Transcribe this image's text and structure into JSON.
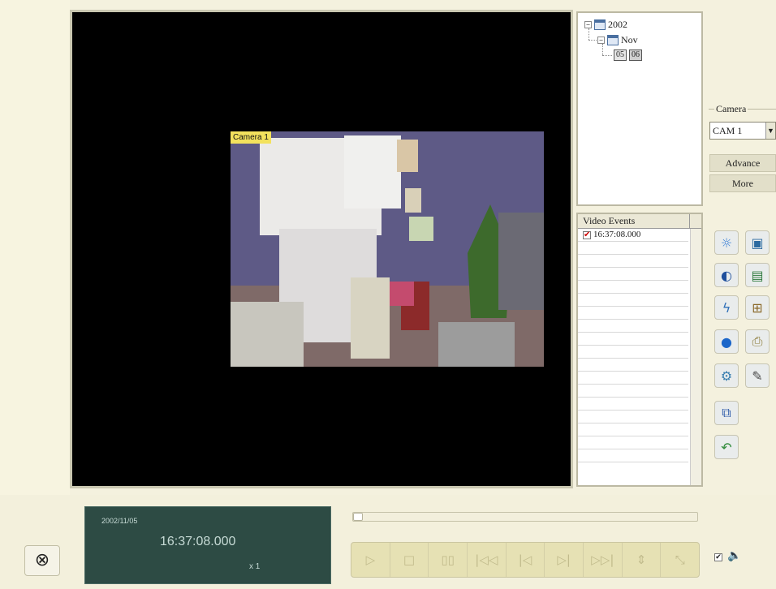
{
  "tree": {
    "year": "2002",
    "month": "Nov",
    "day_label": "05",
    "day_number": "06"
  },
  "camera": {
    "group_title": "Camera",
    "selected": "CAM 1",
    "advance_label": "Advance",
    "more_label": "More"
  },
  "video": {
    "overlay_label": "Camera 1"
  },
  "events": {
    "header": "Video Events",
    "items": [
      "16:37:08.000"
    ]
  },
  "timecode": {
    "date": "2002/11/05",
    "time": "16:37:08.000",
    "speed": "x 1"
  },
  "tools": {
    "left_column": [
      "brightness-icon",
      "contrast-icon",
      "sharpen-icon",
      "color-icon",
      "settings-icon",
      "copy-icon",
      "undo-icon"
    ],
    "right_column": [
      "snapshot-icon",
      "save-bmp-icon",
      "export-icon",
      "print-icon",
      "edit-icon"
    ]
  },
  "transport": {
    "buttons": [
      "play",
      "stop",
      "pause",
      "first-frame",
      "previous-frame",
      "next-frame",
      "last-frame",
      "speed-toggle",
      "zoom"
    ]
  },
  "audio": {
    "checked": true
  }
}
